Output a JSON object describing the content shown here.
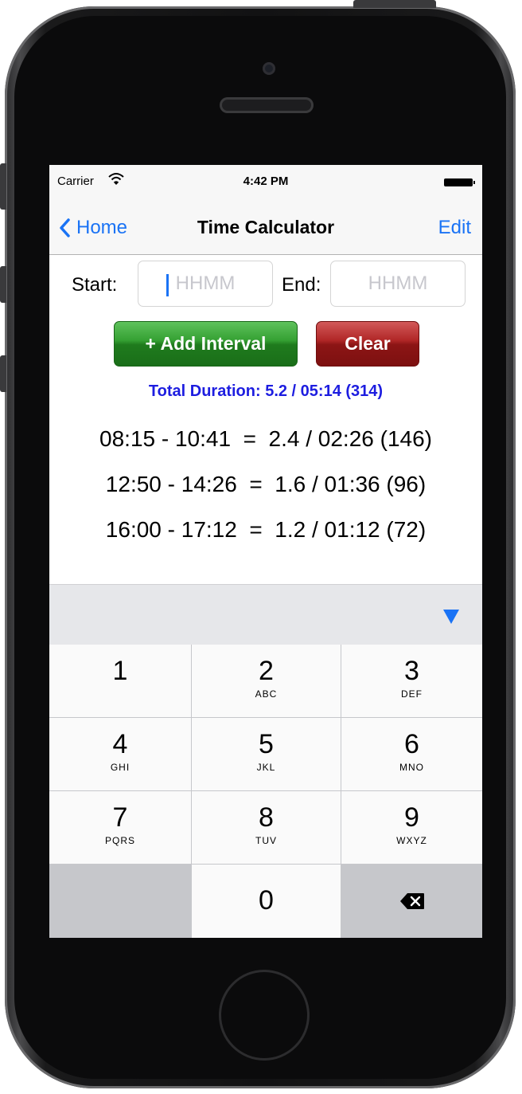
{
  "status_bar": {
    "carrier": "Carrier",
    "time": "4:42 PM",
    "wifi_icon": "wifi-icon",
    "battery_icon": "battery-icon"
  },
  "nav": {
    "back_label": "Home",
    "title": "Time Calculator",
    "edit_label": "Edit",
    "back_icon": "chevron-left-icon"
  },
  "inputs": {
    "start_label": "Start:",
    "start_value": "",
    "start_placeholder": "HHMM",
    "end_label": "End:",
    "end_value": "",
    "end_placeholder": "HHMM"
  },
  "buttons": {
    "add_interval": "+ Add Interval",
    "clear": "Clear"
  },
  "total": "Total Duration: 5.2 / 05:14 (314)",
  "intervals": [
    "08:15 - 10:41  =  2.4 / 02:26 (146)",
    "12:50 - 14:26  =  1.6 / 01:36 (96)",
    "16:00 - 17:12  =  1.2 / 01:12 (72)"
  ],
  "keyboard": {
    "dismiss_icon": "triangle-down-icon",
    "keys": [
      {
        "num": "1",
        "letters": ""
      },
      {
        "num": "2",
        "letters": "ABC"
      },
      {
        "num": "3",
        "letters": "DEF"
      },
      {
        "num": "4",
        "letters": "GHI"
      },
      {
        "num": "5",
        "letters": "JKL"
      },
      {
        "num": "6",
        "letters": "MNO"
      },
      {
        "num": "7",
        "letters": "PQRS"
      },
      {
        "num": "8",
        "letters": "TUV"
      },
      {
        "num": "9",
        "letters": "WXYZ"
      },
      {
        "num": "0",
        "letters": ""
      }
    ],
    "delete_icon": "backspace-icon"
  },
  "colors": {
    "accent": "#1a73f5",
    "total_text": "#1d1de0",
    "add_button": "#35a133",
    "clear_button": "#b12727"
  }
}
